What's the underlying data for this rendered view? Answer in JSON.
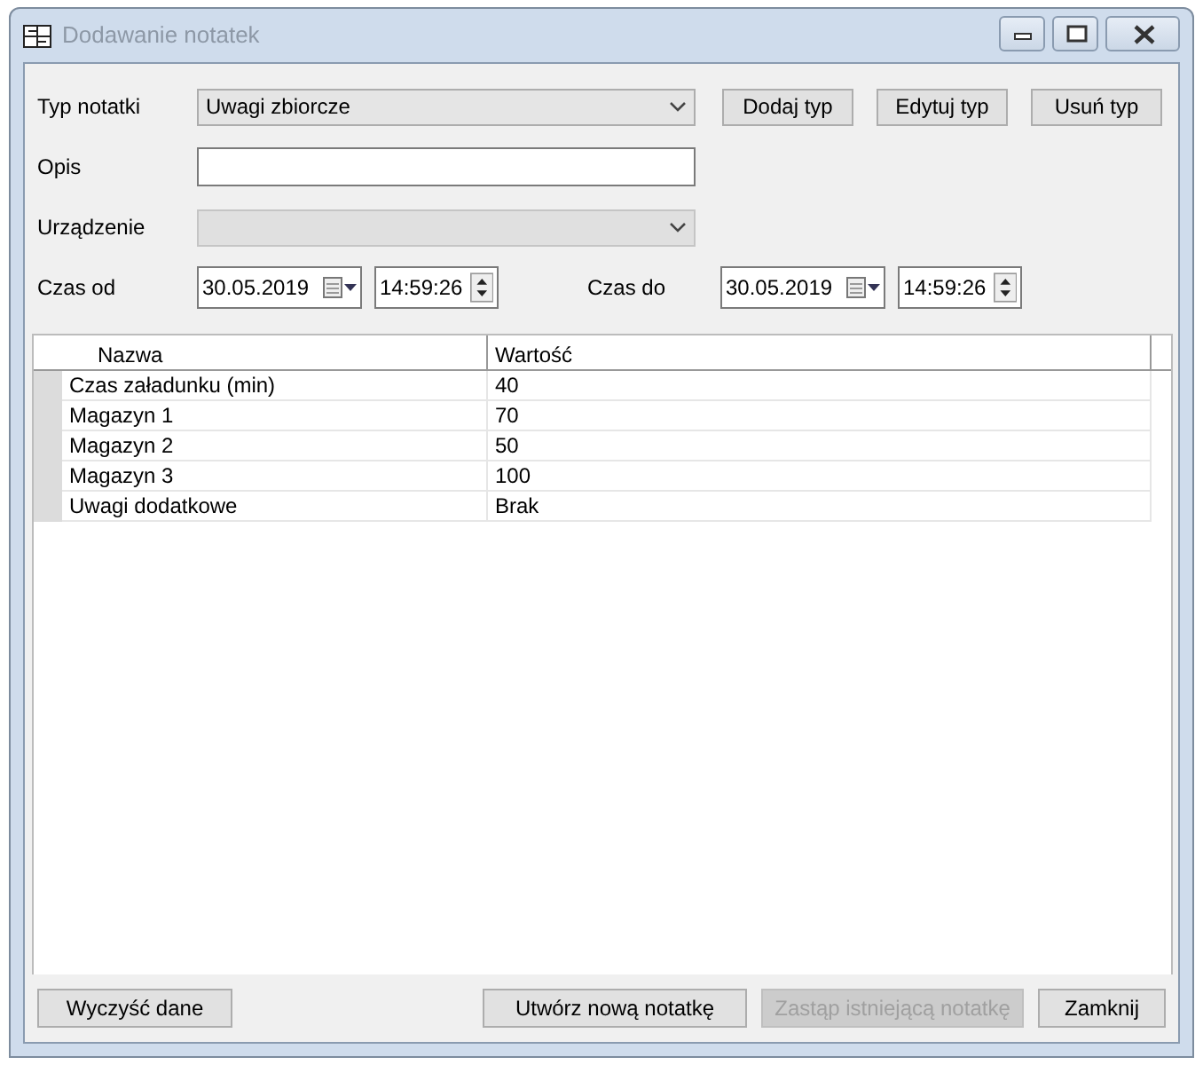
{
  "window": {
    "title": "Dodawanie notatek",
    "active": false
  },
  "form": [
    {
      "kind": "combo",
      "label": "Typ notatki",
      "value": "Uwagi zbiorcze",
      "disabled": false,
      "buttons": [
        "Dodaj typ",
        "Edytuj typ",
        "Usuń typ"
      ]
    },
    {
      "kind": "text",
      "label": "Opis"
    },
    {
      "kind": "combo",
      "label": "Urządzenie",
      "disabled": true
    },
    {
      "kind": "range",
      "label": "Czas od",
      "from": {
        "date": "30.05.2019",
        "time": "14:59:26"
      },
      "to_label": "Czas do",
      "to": {
        "date": "30.05.2019",
        "time": "14:59:26"
      }
    }
  ],
  "grid": {
    "columns": [
      "Nazwa",
      "Wartość"
    ],
    "rows": [
      {
        "name": "Czas załadunku (min)",
        "value": "40"
      },
      {
        "name": "Magazyn 1",
        "value": "70"
      },
      {
        "name": "Magazyn 2",
        "value": "50"
      },
      {
        "name": "Magazyn 3",
        "value": "100"
      },
      {
        "name": "Uwagi dodatkowe",
        "value": "Brak"
      }
    ]
  },
  "buttons": [
    {
      "label": "Wyczyść dane",
      "disabled": false
    },
    {
      "label": "Utwórz nową notatkę",
      "disabled": false
    },
    {
      "label": "Zastąp istniejącą notatkę",
      "disabled": true
    },
    {
      "label": "Zamknij",
      "disabled": false
    }
  ]
}
